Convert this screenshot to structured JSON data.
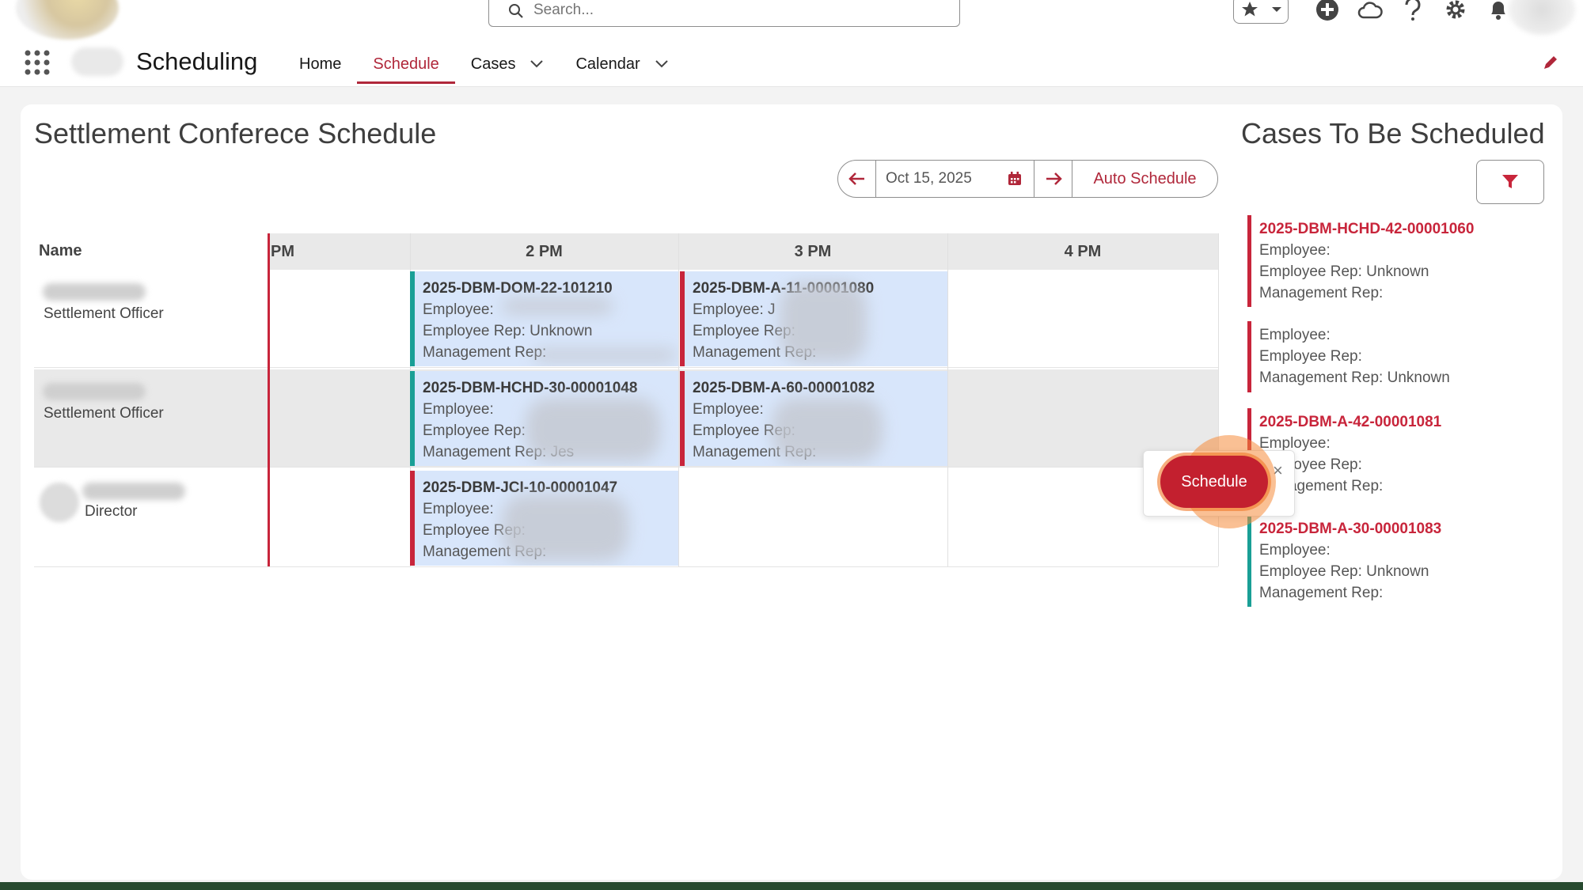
{
  "header": {
    "search_placeholder": "Search...",
    "app_name": "Scheduling",
    "nav": [
      {
        "label": "Home",
        "active": false
      },
      {
        "label": "Schedule",
        "active": true
      },
      {
        "label": "Cases",
        "active": false
      },
      {
        "label": "Calendar",
        "active": false
      }
    ]
  },
  "page": {
    "title": "Settlement Conferece Schedule",
    "date": "Oct 15, 2025",
    "auto_schedule": "Auto Schedule",
    "name_header": "Name",
    "time_headers": [
      "PM",
      "2 PM",
      "3 PM",
      "4 PM"
    ]
  },
  "people": [
    {
      "role": "Settlement Officer"
    },
    {
      "role": "Settlement Officer"
    },
    {
      "role": "Director"
    }
  ],
  "events": [
    {
      "title": "2025-DBM-DOM-22-101210",
      "employee": "Employee:",
      "emp_rep": "Employee Rep: Unknown",
      "mgmt_rep": "Management Rep:"
    },
    {
      "title": "2025-DBM-A-11-00001080",
      "employee": "Employee: J",
      "emp_rep": "Employee Rep:",
      "mgmt_rep": "Management Rep:"
    },
    {
      "title": "2025-DBM-HCHD-30-00001048",
      "employee": "Employee:",
      "emp_rep": "Employee Rep:",
      "mgmt_rep": "Management Rep: Jes"
    },
    {
      "title": "2025-DBM-A-60-00001082",
      "employee": "Employee:",
      "emp_rep": "Employee Rep:",
      "mgmt_rep": "Management Rep:"
    },
    {
      "title": "2025-DBM-JCI-10-00001047",
      "employee": "Employee:",
      "emp_rep": "Employee Rep:",
      "mgmt_rep": "Management Rep:"
    }
  ],
  "cases_panel": {
    "title": "Cases To Be Scheduled",
    "cases": [
      {
        "title": "2025-DBM-HCHD-42-00001060",
        "employee": "Employee:",
        "emp_rep": "Employee Rep: Unknown",
        "mgmt_rep": "Management Rep:"
      },
      {
        "title": "",
        "employee": "Employee:",
        "emp_rep": "Employee Rep:",
        "mgmt_rep": "Management Rep: Unknown"
      },
      {
        "title": "2025-DBM-A-42-00001081",
        "employee": "Employee:",
        "emp_rep": "Employee Rep:",
        "mgmt_rep": "Management Rep:"
      },
      {
        "title": "2025-DBM-A-30-00001083",
        "employee": "Employee:",
        "emp_rep": "Employee Rep: Unknown",
        "mgmt_rep": "Management Rep:"
      }
    ]
  },
  "popover": {
    "button": "Schedule",
    "close": "×"
  },
  "colors": {
    "accent": "#c8253b",
    "teal": "#1a9f96",
    "event_bg": "#d8e6fb"
  }
}
